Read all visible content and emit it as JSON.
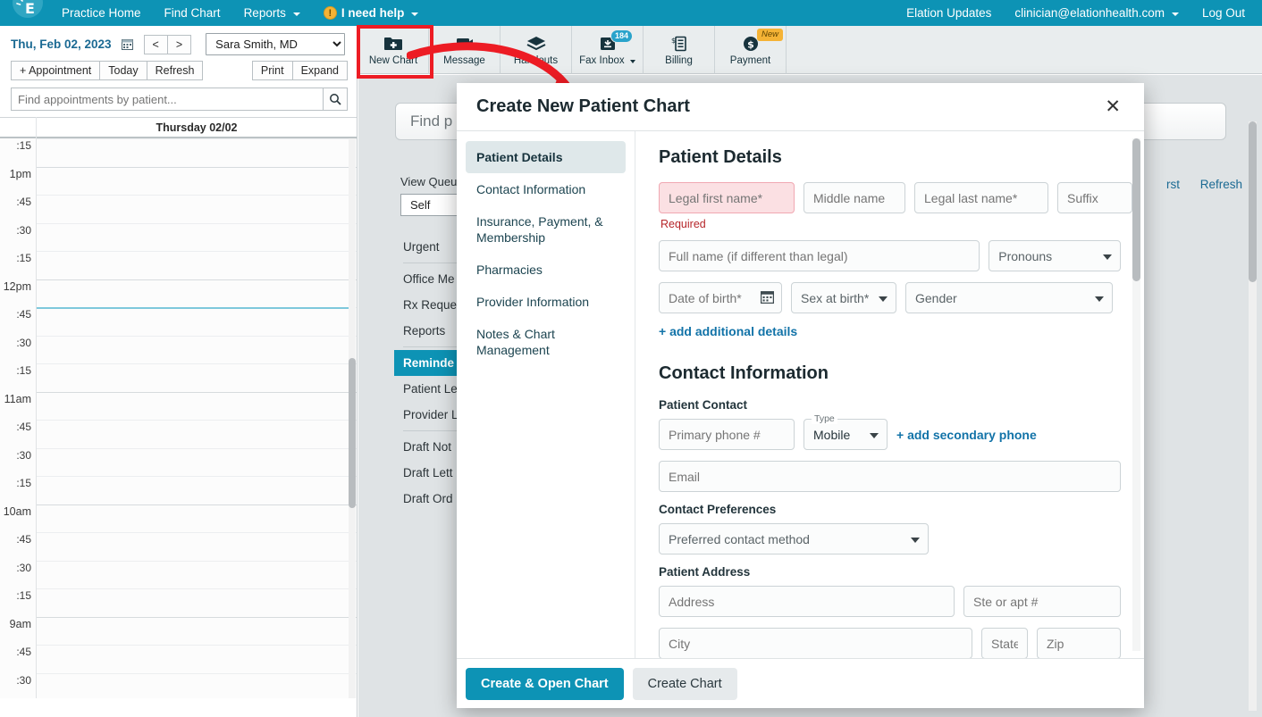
{
  "topnav": {
    "logo_name": "elation-logo",
    "links": [
      {
        "label": "Practice Home",
        "name": "nav-practice-home",
        "caret": false
      },
      {
        "label": "Find Chart",
        "name": "nav-find-chart",
        "caret": false
      },
      {
        "label": "Reports",
        "name": "nav-reports",
        "caret": true
      }
    ],
    "help": {
      "label": "I need help",
      "icon": "warning-icon",
      "glyph": "!",
      "caret": true
    },
    "right": [
      {
        "label": "Elation Updates",
        "name": "nav-elation-updates",
        "caret": false
      },
      {
        "label": "clinician@elationhealth.com",
        "name": "nav-user-account",
        "caret": true
      },
      {
        "label": "Log Out",
        "name": "nav-log-out",
        "caret": false
      }
    ]
  },
  "toolbar": {
    "items": [
      {
        "label": "New Chart",
        "icon": "folder-plus-icon",
        "badge": null,
        "new": false,
        "caret": false
      },
      {
        "label": "Message",
        "icon": "message-icon",
        "badge": null,
        "new": false,
        "caret": false
      },
      {
        "label": "Handouts",
        "icon": "handouts-icon",
        "badge": null,
        "new": false,
        "caret": false
      },
      {
        "label": "Fax Inbox",
        "icon": "fax-inbox-icon",
        "badge": "184",
        "new": false,
        "caret": true
      },
      {
        "label": "Billing",
        "icon": "billing-icon",
        "badge": null,
        "new": false,
        "caret": false
      },
      {
        "label": "Payment",
        "icon": "payment-dollar-icon",
        "badge": null,
        "new": true,
        "new_label": "New",
        "caret": false
      }
    ]
  },
  "schedule": {
    "date_label": "Thu, Feb 02, 2023",
    "calendar_icon": "calendar-icon",
    "prev_label": "<",
    "next_label": ">",
    "provider_value": "Sara Smith, MD",
    "provider_options": [
      "Sara Smith, MD"
    ],
    "buttons": [
      {
        "label": "+ Appointment",
        "name": "add-appointment-button"
      },
      {
        "label": "Today",
        "name": "today-button"
      },
      {
        "label": "Refresh",
        "name": "refresh-schedule-button"
      }
    ],
    "right_buttons": [
      {
        "label": "Print",
        "name": "print-button"
      },
      {
        "label": "Expand",
        "name": "expand-button"
      }
    ],
    "search_placeholder": "Find appointments by patient...",
    "search_value": "",
    "search_icon": "search-icon",
    "day_header": "Thursday 02/02",
    "slots": [
      {
        "label": ":30",
        "hour": false
      },
      {
        "label": ":45",
        "hour": false
      },
      {
        "label": "9am",
        "hour": true
      },
      {
        "label": ":15",
        "hour": false
      },
      {
        "label": ":30",
        "hour": false
      },
      {
        "label": ":45",
        "hour": false
      },
      {
        "label": "10am",
        "hour": true
      },
      {
        "label": ":15",
        "hour": false
      },
      {
        "label": ":30",
        "hour": false
      },
      {
        "label": ":45",
        "hour": false
      },
      {
        "label": "11am",
        "hour": true
      },
      {
        "label": ":15",
        "hour": false
      },
      {
        "label": ":30",
        "hour": false
      },
      {
        "label": ":45",
        "hour": false,
        "nowline": true
      },
      {
        "label": "12pm",
        "hour": true
      },
      {
        "label": ":15",
        "hour": false
      },
      {
        "label": ":30",
        "hour": false
      },
      {
        "label": ":45",
        "hour": false
      },
      {
        "label": "1pm",
        "hour": true
      },
      {
        "label": ":15",
        "hour": false
      }
    ]
  },
  "background": {
    "find_patient_placeholder": "Find p",
    "view_queue_label": "View Queu",
    "queue_select_value": "Self",
    "sort_link": "rst",
    "refresh_link": "Refresh",
    "queue_items": [
      {
        "label": "Urgent",
        "active": false,
        "sep_after": true
      },
      {
        "label": "Office Me",
        "active": false,
        "sep_after": false
      },
      {
        "label": "Rx Reques",
        "active": false,
        "sep_after": false
      },
      {
        "label": "Reports",
        "active": false,
        "sep_after": true
      },
      {
        "label": "Reminde",
        "active": true,
        "sep_after": false
      },
      {
        "label": "Patient Le",
        "active": false,
        "sep_after": false
      },
      {
        "label": "Provider L",
        "active": false,
        "sep_after": true
      },
      {
        "label": "Draft Not",
        "active": false,
        "sep_after": false
      },
      {
        "label": "Draft Lett",
        "active": false,
        "sep_after": false
      },
      {
        "label": "Draft Ord",
        "active": false,
        "sep_after": false
      }
    ]
  },
  "modal": {
    "title": "Create New Patient Chart",
    "close_label": "✕",
    "nav": [
      {
        "label": "Patient Details",
        "active": true,
        "name": "modal-nav-patient-details"
      },
      {
        "label": "Contact Information",
        "active": false,
        "name": "modal-nav-contact-information"
      },
      {
        "label": "Insurance, Payment, & Membership",
        "active": false,
        "name": "modal-nav-insurance"
      },
      {
        "label": "Pharmacies",
        "active": false,
        "name": "modal-nav-pharmacies"
      },
      {
        "label": "Provider Information",
        "active": false,
        "name": "modal-nav-provider-information"
      },
      {
        "label": "Notes & Chart Management",
        "active": false,
        "name": "modal-nav-notes-chart-management"
      }
    ],
    "patient_details": {
      "heading": "Patient Details",
      "legal_first_name_placeholder": "Legal first name*",
      "legal_first_name_value": "",
      "required_error": "Required",
      "middle_name_placeholder": "Middle name",
      "middle_name_value": "",
      "legal_last_name_placeholder": "Legal last name*",
      "legal_last_name_value": "",
      "suffix_placeholder": "Suffix",
      "suffix_value": "",
      "full_name_placeholder": "Full name (if different than legal)",
      "full_name_value": "",
      "pronouns_value": "Pronouns",
      "dob_placeholder": "Date of birth*",
      "dob_value": "",
      "dob_icon": "calendar-icon",
      "sex_at_birth_value": "Sex at birth*",
      "gender_value": "Gender",
      "add_additional_details": "+ add additional details"
    },
    "contact_information": {
      "heading": "Contact Information",
      "patient_contact_label": "Patient Contact",
      "primary_phone_placeholder": "Primary phone #",
      "primary_phone_value": "",
      "phone_type_label": "Type",
      "phone_type_value": "Mobile",
      "add_secondary_phone": "+ add secondary phone",
      "email_placeholder": "Email",
      "email_value": "",
      "contact_preferences_label": "Contact Preferences",
      "preferred_contact_method_value": "Preferred contact method",
      "patient_address_label": "Patient Address",
      "address_placeholder": "Address",
      "address_value": "",
      "ste_apt_placeholder": "Ste or apt #",
      "ste_apt_value": "",
      "city_placeholder": "City",
      "city_value": "",
      "state_placeholder": "State",
      "state_value": "",
      "zip_placeholder": "Zip",
      "zip_value": ""
    },
    "footer": {
      "primary_label": "Create & Open Chart",
      "secondary_label": "Create Chart"
    }
  },
  "colors": {
    "brand_teal": "#0d93b5",
    "accent_link": "#1273a8",
    "error_red": "#b6262a",
    "highlight_red": "#ed1c24",
    "badge_orange": "#f5b335"
  }
}
